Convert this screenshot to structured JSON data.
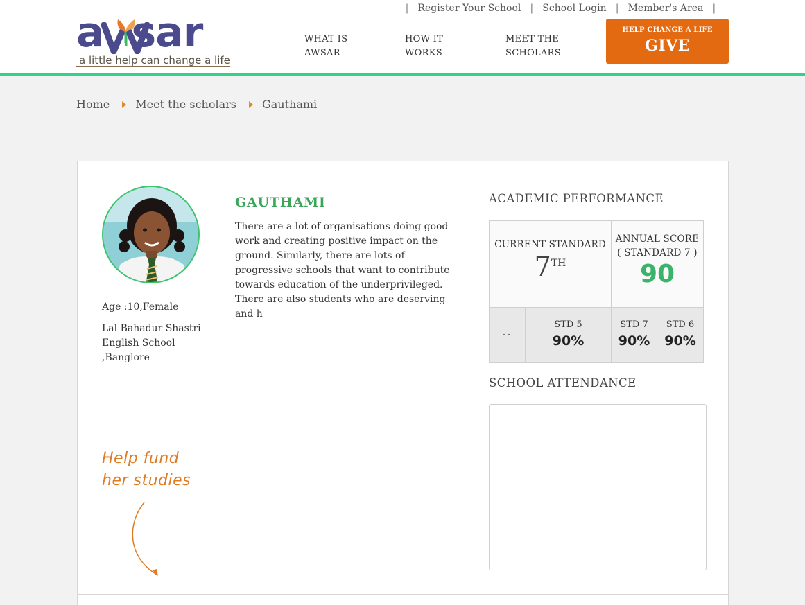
{
  "brand": {
    "logo_text": "awsar",
    "tagline": "a little help can change a life",
    "colors": {
      "primary": "#4b4a8c",
      "accent": "#e36a10",
      "green": "#3bb36a",
      "rule": "#2fd389"
    }
  },
  "utility_nav": {
    "items": [
      {
        "label": "Register Your School"
      },
      {
        "label": "School Login"
      },
      {
        "label": "Member's Area"
      }
    ],
    "separator": "|"
  },
  "main_nav": {
    "items": [
      {
        "label_line1": "WHAT IS",
        "label_line2": "AWSAR"
      },
      {
        "label_line1": "HOW IT",
        "label_line2": "WORKS"
      },
      {
        "label_line1": "MEET THE",
        "label_line2": "SCHOLARS"
      }
    ]
  },
  "give_button": {
    "small_label": "HELP CHANGE A LIFE",
    "label": "GIVE"
  },
  "breadcrumb": {
    "items": [
      {
        "label": "Home"
      },
      {
        "label": "Meet the scholars"
      },
      {
        "label": "Gauthami"
      }
    ]
  },
  "scholar": {
    "name": "GAUTHAMI",
    "bio": "There are a lot of organisations doing good work and creating positive impact on the ground. Similarly, there are lots of progressive schools that want to contribute towards education of the underprivileged. There are also students who are deserving and h",
    "age_gender": "Age :10,Female",
    "school_line1": "Lal Bahadur Shastri",
    "school_line2": "English School",
    "school_line3": ",Banglore",
    "photo_icon": "student-portrait",
    "help_fund_line1": "Help fund",
    "help_fund_line2": "her studies"
  },
  "academic": {
    "heading": "ACADEMIC PERFORMANCE",
    "current_standard_label": "CURRENT STANDARD",
    "current_standard_value": "7",
    "current_standard_suffix": "TH",
    "annual_score_label": "ANNUAL SCORE",
    "annual_score_sub": "( STANDARD 7 )",
    "annual_score_value": "90",
    "history": {
      "na": "--",
      "std5_label": "STD 5",
      "std5_value": "90%",
      "std7_label": "STD 7",
      "std7_value": "90%",
      "std6_label": "STD 6",
      "std6_value": "90%"
    }
  },
  "attendance": {
    "heading": "SCHOOL ATTENDANCE"
  }
}
